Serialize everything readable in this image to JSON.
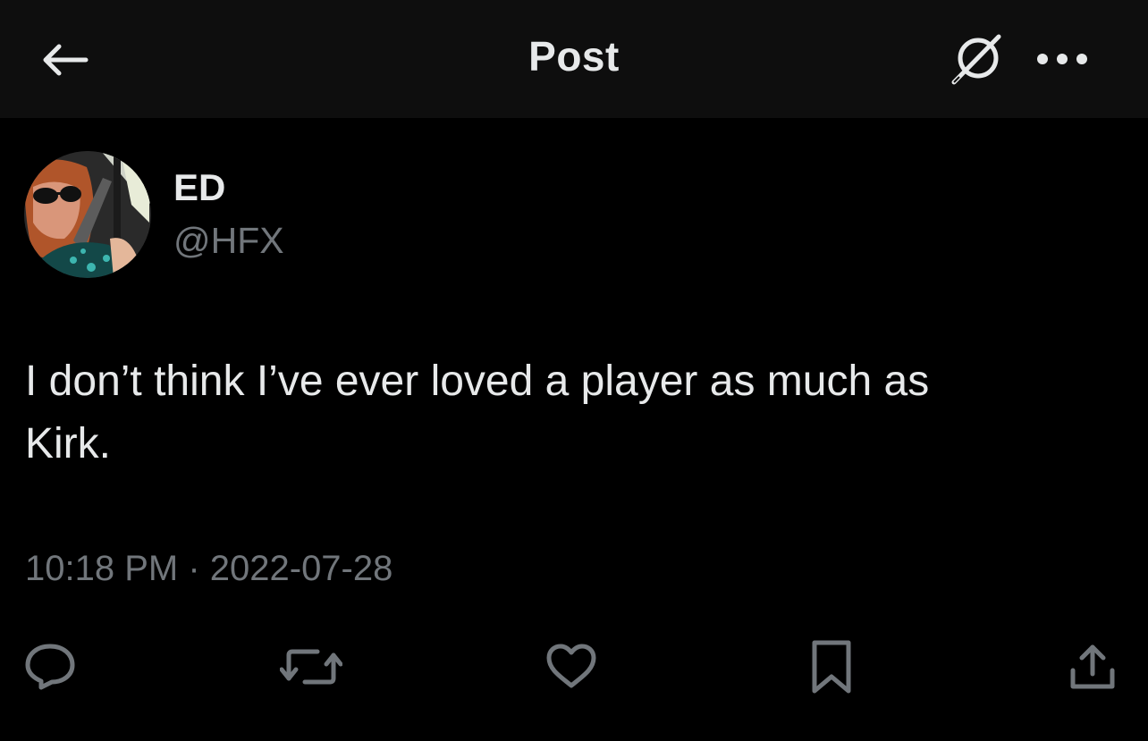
{
  "header": {
    "title": "Post",
    "back_icon": "arrow-left-icon",
    "grok_icon": "grok-icon",
    "more_icon": "more-dots-icon"
  },
  "post": {
    "author": {
      "display_name": "ED",
      "handle": "@HFX",
      "avatar": "user-avatar"
    },
    "text_line1": "I don’t think I’ve ever loved a player as much as",
    "text_line2": "Kirk.",
    "timestamp": "10:18 PM · 2022-07-28"
  },
  "actions": {
    "reply_icon": "reply-icon",
    "repost_icon": "repost-icon",
    "like_icon": "heart-icon",
    "bookmark_icon": "bookmark-icon",
    "share_icon": "share-icon"
  },
  "colors": {
    "background": "#000000",
    "header_background": "#0e0e0e",
    "primary_text": "#e7e9ea",
    "secondary_text": "#71767b"
  }
}
